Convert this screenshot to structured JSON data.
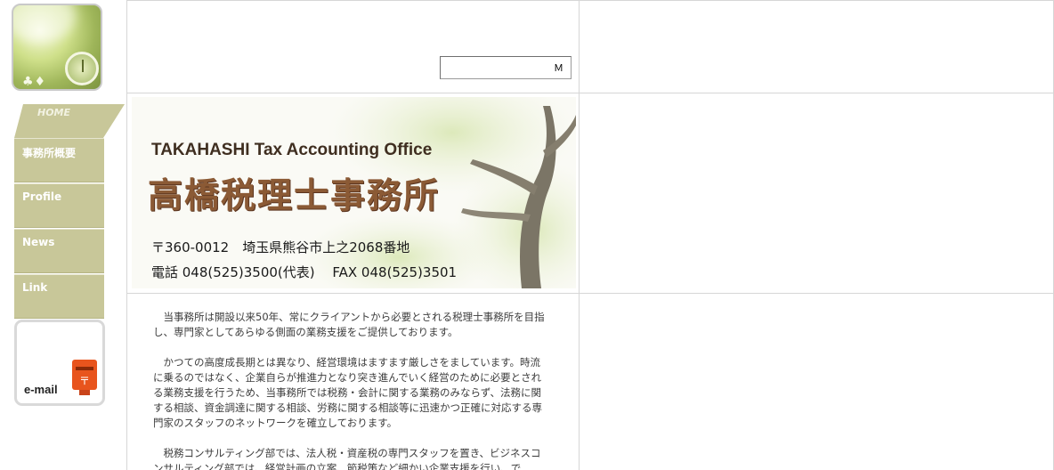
{
  "nav": {
    "home": "HOME",
    "items": [
      {
        "label": "事務所概要"
      },
      {
        "label": "Profile"
      },
      {
        "label": "News"
      },
      {
        "label": "Link"
      }
    ],
    "email": "e-mail"
  },
  "search": {
    "value": "Ｍ"
  },
  "banner": {
    "title_en": "TAKAHASHI Tax Accounting Office",
    "title_jp": "高橋税理士事務所",
    "address": "〒360-0012　埼玉県熊谷市上之2068番地",
    "phone": "電話 048(525)3500(代表)　 FAX 048(525)3501"
  },
  "content": {
    "paragraphs": [
      "　当事務所は開設以来50年、常にクライアントから必要とされる税理士事務所を目指し、専門家としてあらゆる側面の業務支援をご提供しております。",
      "　かつての高度成長期とは異なり、経営環境はますます厳しさをましています。時流に乗るのではなく、企業自らが推進力となり突き進んでいく経営のために必要とされる業務支援を行うため、当事務所では税務・会計に関する業務のみならず、法務に関する相談、資金調達に関する相談、労務に関する相談等に迅速かつ正確に対応する専門家のスタッフのネットワークを確立しております。",
      "　税務コンサルティング部では、法人税・資産税の専門スタッフを置き、ビジネスコンサルティング部では、経営計画の立案、節税策など細かい企業支援を行い、で"
    ]
  },
  "colors": {
    "nav_bg": "#c8c799",
    "banner_text": "#8b5a35",
    "border": "#d6d6d6"
  }
}
